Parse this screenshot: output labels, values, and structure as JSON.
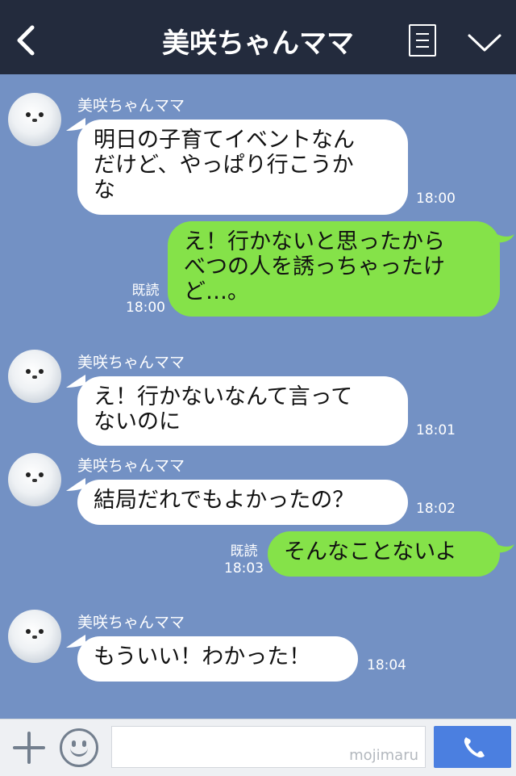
{
  "header": {
    "title": "美咲ちゃんママ",
    "back_icon": "chevron-left-icon",
    "menu_icon": "menu-list-icon",
    "expand_icon": "chevron-down-icon",
    "background": "#232b3d"
  },
  "chat": {
    "background": "#7391c4",
    "messages": [
      {
        "direction": "incoming",
        "sender": "美咲ちゃんママ",
        "text": "明日の子育てイベントなん\nだけど、やっぱり行こうか\nな",
        "time": "18:00"
      },
      {
        "direction": "outgoing",
        "read": "既読",
        "text": "え！行かないと思ったから\nべつの人を誘っちゃったけ\nど…。",
        "time": "18:00"
      },
      {
        "direction": "incoming",
        "sender": "美咲ちゃんママ",
        "text": "え！行かないなんて言って\nないのに",
        "time": "18:01"
      },
      {
        "direction": "incoming",
        "sender": "美咲ちゃんママ",
        "text": "結局だれでもよかったの？",
        "time": "18:02"
      },
      {
        "direction": "outgoing",
        "read": "既読",
        "text": "そんなことないよ",
        "time": "18:03"
      },
      {
        "direction": "incoming",
        "sender": "美咲ちゃんママ",
        "text": "もういい！わかった！",
        "time": "18:04"
      }
    ]
  },
  "footer": {
    "plus_icon": "plus-icon",
    "emoji_icon": "smiley-icon",
    "input_value": "",
    "watermark": "mojimaru",
    "call_icon": "phone-icon",
    "call_color": "#4b7fe0"
  },
  "colors": {
    "incoming_bubble": "#ffffff",
    "outgoing_bubble": "#85e249"
  }
}
